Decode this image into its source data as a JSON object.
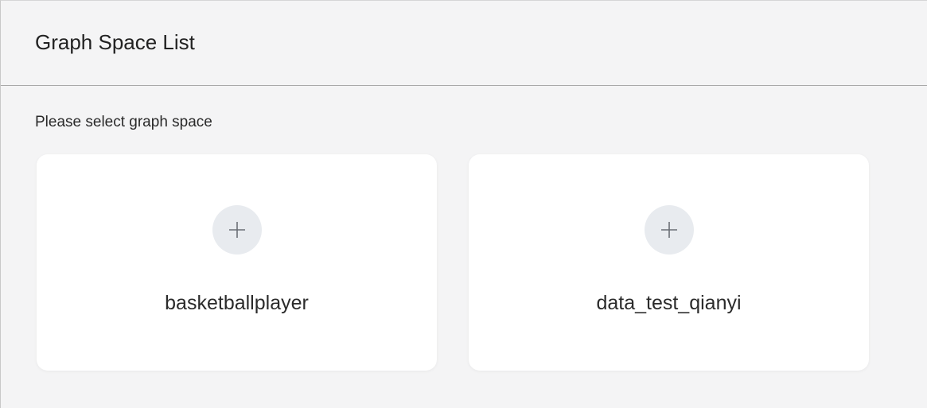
{
  "header": {
    "title": "Graph Space List"
  },
  "content": {
    "subtitle": "Please select graph space",
    "spaces": [
      {
        "name": "basketballplayer",
        "icon": "plus-icon"
      },
      {
        "name": "data_test_qianyi",
        "icon": "plus-icon"
      }
    ]
  },
  "colors": {
    "background": "#f4f4f5",
    "card": "#ffffff",
    "icon_circle": "#e8ebef",
    "text": "#222222"
  }
}
